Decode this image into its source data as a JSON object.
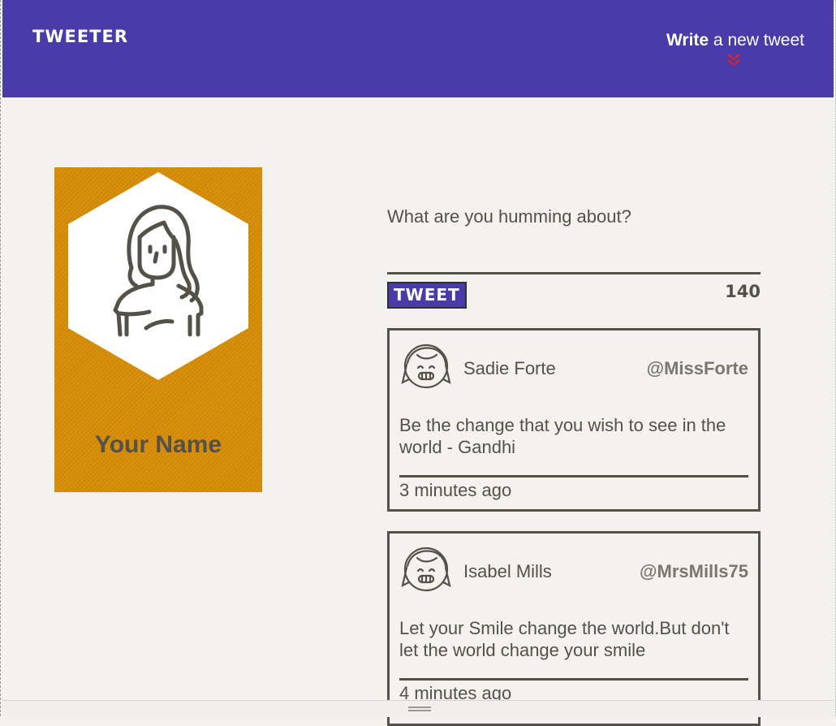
{
  "header": {
    "brand": "TWEETER",
    "compose_bold": "Write",
    "compose_rest": " a new tweet",
    "accent_color": "#4a3ca8",
    "chevron_color": "#d0243a",
    "chevron_icon": "double-chevron-down-icon"
  },
  "profile": {
    "name": "Your Name",
    "background": "#d78c07",
    "avatar_icon": "girl-avatar-icon"
  },
  "composer": {
    "placeholder": "What are you humming about?",
    "button_label": "TWEET",
    "counter": "140"
  },
  "tweets": [
    {
      "name": "Sadie Forte",
      "handle": "@MissForte",
      "text": "Be the change that you wish to see in the world - Gandhi",
      "time": "3 minutes ago",
      "avatar_icon": "smiling-girl-avatar-icon"
    },
    {
      "name": "Isabel Mills",
      "handle": "@MrsMills75",
      "text": "Let your Smile change the world.But don't let the world change your smile",
      "time": "4 minutes ago",
      "avatar_icon": "smiling-girl-avatar-icon"
    }
  ]
}
